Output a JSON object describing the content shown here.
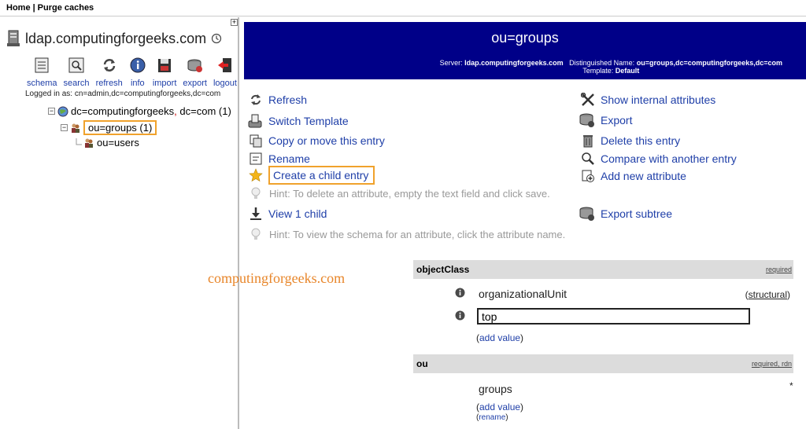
{
  "topbar": {
    "home": "Home",
    "separator": "|",
    "purge": "Purge caches"
  },
  "expand_symbol": "+",
  "server": {
    "name": "ldap.computingforgeeks.com"
  },
  "toolbar": [
    {
      "label": "schema",
      "icon": "schema-icon"
    },
    {
      "label": "search",
      "icon": "search-icon"
    },
    {
      "label": "refresh",
      "icon": "refresh-icon"
    },
    {
      "label": "info",
      "icon": "info-icon"
    },
    {
      "label": "import",
      "icon": "import-icon"
    },
    {
      "label": "export",
      "icon": "export-icon"
    },
    {
      "label": "logout",
      "icon": "logout-icon"
    }
  ],
  "logged_in": "Logged in as: cn=admin,dc=computingforgeeks,dc=com",
  "tree": {
    "root": {
      "toggle": "−",
      "part1": "dc=computingforgeeks",
      "comma": ",",
      "part2": " dc=com (1)"
    },
    "groups": {
      "toggle": "−",
      "label": "ou=groups (1)"
    },
    "users": {
      "label": "ou=users"
    }
  },
  "banner": {
    "title": "ou=groups",
    "server_label": "Server:",
    "server_value": "ldap.computingforgeeks.com",
    "dn_label": "Distinguished Name:",
    "dn_value": "ou=groups,dc=computingforgeeks,dc=com",
    "template_label": "Template:",
    "template_value": "Default"
  },
  "actions_left": {
    "refresh": "Refresh",
    "switch_template": "Switch Template",
    "copy_move": "Copy or move this entry",
    "rename": "Rename",
    "create_child": "Create a child entry",
    "hint_delete": "Hint: To delete an attribute, empty the text field and click save.",
    "view_child": "View 1 child",
    "hint_schema": "Hint: To view the schema for an attribute, click the attribute name."
  },
  "actions_right": {
    "show_internal": "Show internal attributes",
    "export": "Export",
    "delete": "Delete this entry",
    "compare": "Compare with another entry",
    "add_attr": "Add new attribute",
    "export_subtree": "Export subtree"
  },
  "watermark": "computingforgeeks.com",
  "attributes": {
    "objectclass": {
      "name": "objectClass",
      "flag": "required",
      "value1": "organizationalUnit",
      "value1_note": "structural",
      "value2": "top",
      "add_value": "add value"
    },
    "ou": {
      "name": "ou",
      "flag_required": "required",
      "flag_sep": ", ",
      "flag_rdn": "rdn",
      "value": "groups",
      "star": "*",
      "add_value": "add value",
      "rename": "rename"
    }
  },
  "colors": {
    "banner": "#000088",
    "link": "#1f3fa8",
    "highlight": "#f0a22c",
    "watermark": "#e8862a"
  }
}
